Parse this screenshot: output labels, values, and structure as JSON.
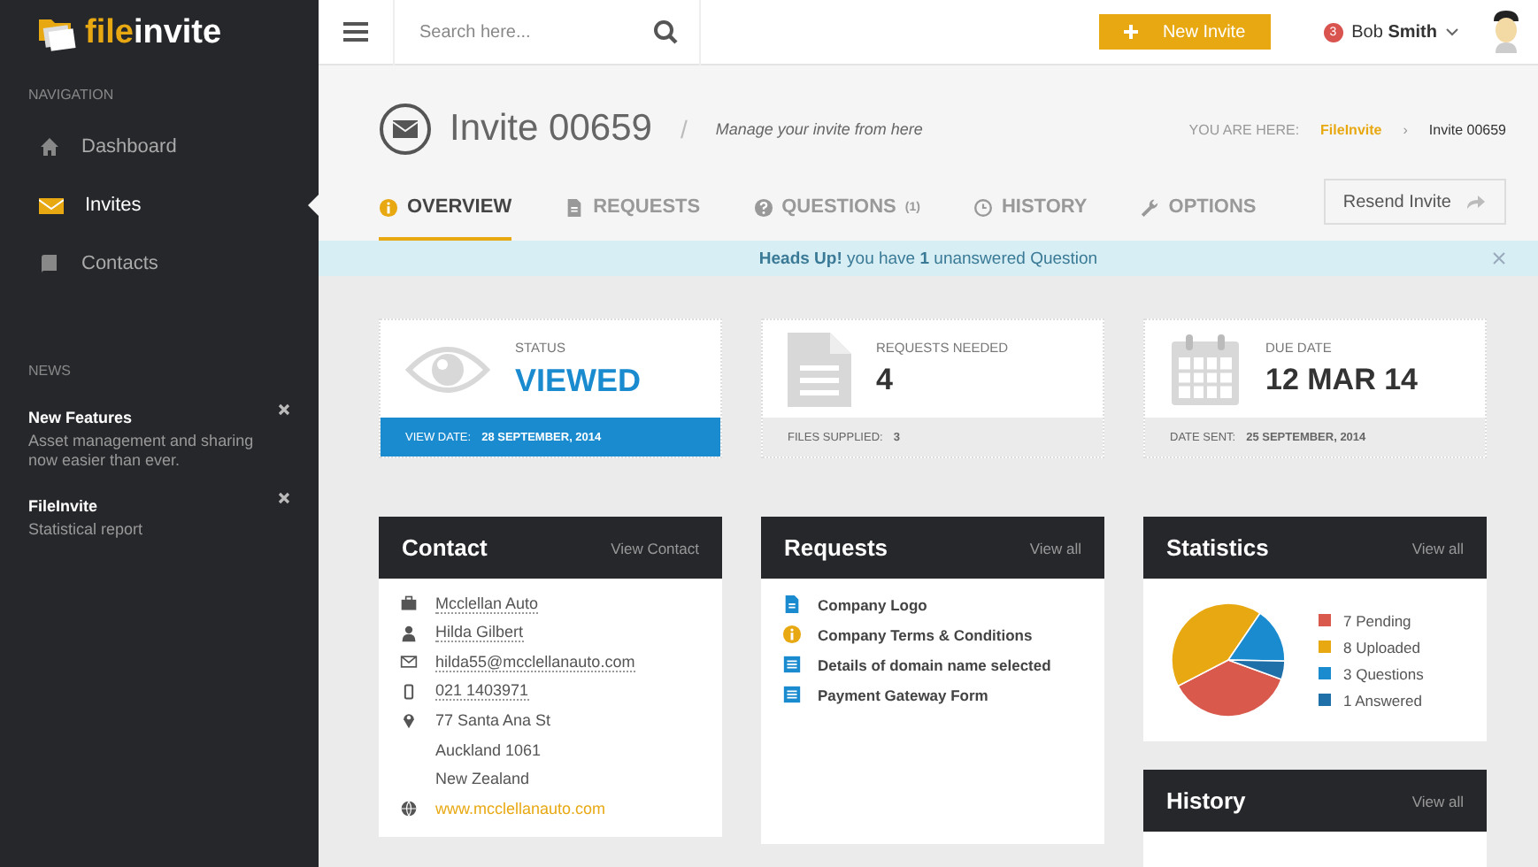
{
  "sidebar": {
    "logo": {
      "part1": "file",
      "part2": "invite"
    },
    "nav_heading": "NAVIGATION",
    "items": [
      {
        "label": "Dashboard",
        "selected": false
      },
      {
        "label": "Invites",
        "selected": true
      },
      {
        "label": "Contacts",
        "selected": false
      }
    ],
    "news_heading": "NEWS",
    "news": [
      {
        "title": "New Features",
        "text": "Asset management and sharing now easier than ever."
      },
      {
        "title": "FileInvite",
        "text": "Statistical report"
      }
    ]
  },
  "topbar": {
    "search": {
      "placeholder": "Search here..."
    },
    "new_button": "New Invite",
    "user": {
      "badge": "3",
      "first": "Bob",
      "last": "Smith"
    }
  },
  "header": {
    "title": "Invite 00659",
    "separator": "/",
    "subtitle": "Manage your invite from here",
    "breadcrumb": {
      "label": "YOU ARE HERE:",
      "separator": "›",
      "items": [
        "FileInvite",
        "Invite 00659"
      ]
    }
  },
  "tabs": [
    {
      "label": "OVERVIEW",
      "selected": true
    },
    {
      "label": "REQUESTS",
      "selected": false
    },
    {
      "label": "QUESTIONS",
      "count": "(1)",
      "selected": false
    },
    {
      "label": "HISTORY",
      "selected": false
    },
    {
      "label": "OPTIONS",
      "selected": false
    }
  ],
  "resend_button": "Resend Invite",
  "alert": {
    "text": "**Heads Up!** you have **1** unanswered Question"
  },
  "summary": [
    {
      "kind": "status",
      "label": "STATUS",
      "value": "VIEWED",
      "footer_label": "VIEW DATE:",
      "footer_value": "28 SEPTEMBER, 2014"
    },
    {
      "kind": "count",
      "label": "REQUESTS NEEDED",
      "value": "4",
      "footer_label": "FILES SUPPLIED:",
      "footer_value": "3"
    },
    {
      "kind": "date",
      "label": "DUE DATE",
      "value": "12 MAR 14",
      "footer_label": "DATE SENT:",
      "footer_value": "25 SEPTEMBER, 2014"
    }
  ],
  "contact": {
    "title": "Contact",
    "link": "View Contact",
    "rows": [
      {
        "kind": "underlined",
        "text": "Mcclellan Auto"
      },
      {
        "kind": "underlined",
        "text": "Hilda Gilbert"
      },
      {
        "kind": "underlined",
        "text": "hilda55@mcclellanauto.com"
      },
      {
        "kind": "underlined",
        "text": "021 1403971"
      },
      {
        "kind": "plain",
        "text": "77 Santa Ana St"
      },
      {
        "kind": "plain",
        "text": "Auckland 1061"
      },
      {
        "kind": "plain",
        "text": "New Zealand"
      },
      {
        "kind": "web",
        "text": "www.mcclellanauto.com"
      }
    ]
  },
  "requests": {
    "title": "Requests",
    "link": "View all",
    "items": [
      {
        "color": "#1b8bd0",
        "text": "Company Logo"
      },
      {
        "color": "#e8a812",
        "text": "Company Terms & Conditions"
      },
      {
        "color": "#1b8bd0",
        "text": "Details of domain name selected"
      },
      {
        "color": "#1b8bd0",
        "text": "Payment Gateway Form"
      }
    ]
  },
  "statistics": {
    "title": "Statistics",
    "link": "View all",
    "chart_data": {
      "type": "pie",
      "categories": [
        "7 Pending",
        "8 Uploaded",
        "3 Questions",
        "1 Answered"
      ],
      "values": [
        7,
        8,
        3,
        1
      ]
    },
    "legend": [
      {
        "color": "#d9594c"
      },
      {
        "color": "#e8a812"
      },
      {
        "color": "#1b8bd0"
      },
      {
        "color": "#1f6fa8"
      }
    ]
  },
  "history": {
    "title": "History",
    "link": "View all"
  }
}
